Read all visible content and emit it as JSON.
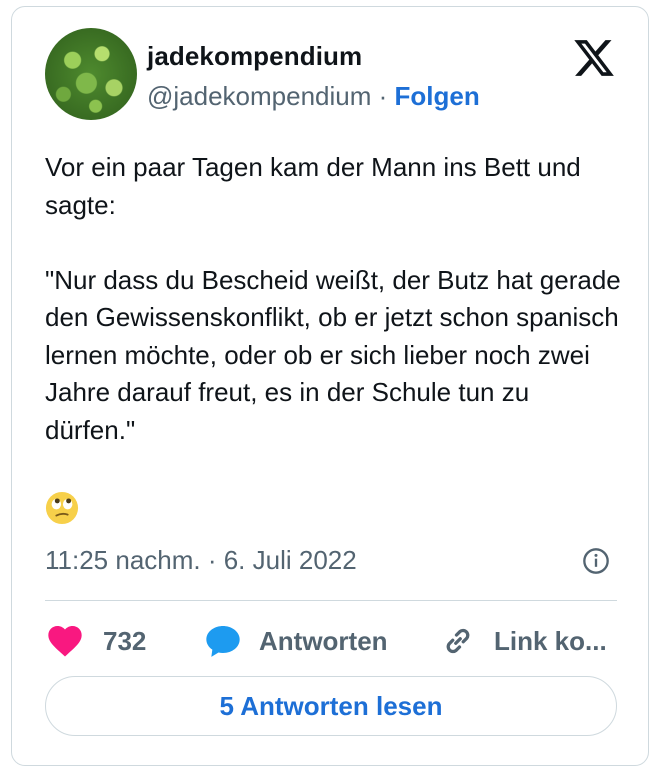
{
  "tweet": {
    "display_name": "jadekompendium",
    "handle": "@jadekompendium",
    "separator": " · ",
    "follow_label": "Folgen",
    "text_paragraphs": [
      "Vor ein paar Tagen kam der Mann ins Bett und sagte:",
      "\"Nur dass du Bescheid weißt, der Butz hat gerade den Gewissenskonflikt, ob er jetzt schon spanisch lernen möchte, oder ob er sich lieber noch zwei Jahre darauf freut, es in der Schule tun zu dürfen.\""
    ],
    "emoji": "face-with-rolling-eyes",
    "timestamp": "11:25 nachm. · 6. Juli 2022"
  },
  "actions": {
    "like_count": "732",
    "reply_label": "Antworten",
    "copy_link_label": "Link ko..."
  },
  "read_replies_label": "5 Antworten lesen",
  "colors": {
    "like": "#f91880",
    "reply": "#1d9bf0",
    "link_text": "#1d6fd6",
    "muted": "#536471",
    "border": "#cfd9de"
  },
  "icons": [
    "x-logo-icon",
    "info-icon",
    "heart-icon",
    "reply-bubble-icon",
    "link-icon"
  ]
}
